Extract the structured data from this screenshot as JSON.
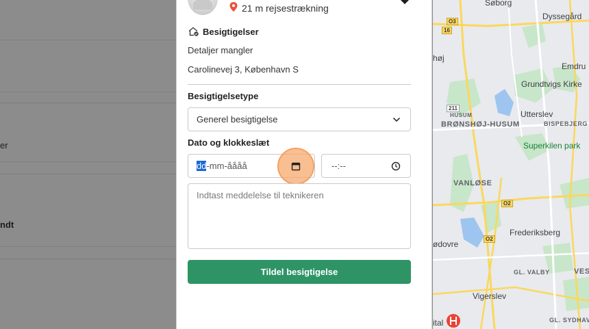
{
  "background_list": {
    "snippets": [
      "er",
      "ndt"
    ]
  },
  "panel": {
    "distance": "21 m rejsestrækning",
    "inspection_section": {
      "title": "Besigtigelser",
      "details": "Detaljer mangler",
      "address": "Carolinevej 3, København S"
    },
    "type_label": "Besigtigelsetype",
    "type_selected": "Generel besigtigelse",
    "datetime_label": "Dato og klokkeslæt",
    "date_placeholder_selected": "dd",
    "date_placeholder_rest": "-mm-åååå",
    "time_placeholder": "--:--",
    "message_placeholder": "Indtast meddelelse til teknikeren",
    "submit_label": "Tildel besigtigelse"
  },
  "map": {
    "places": [
      "Søborg",
      "Dyssegård",
      "Emdru",
      "Grundtvigs Kirke",
      "Utterslev",
      "Superkilen park",
      "Frederiksberg",
      "Vigerslev",
      "høj",
      "ødovre",
      "ital"
    ],
    "districts": [
      "BRØNSHØJ-HUSUM",
      "BISPEBJERG",
      "VANLØSE",
      "GL. VALBY",
      "VES",
      "GL. SYDHAVN",
      "HUSUM"
    ],
    "road_numbers": [
      "O3",
      "16",
      "211",
      "O2",
      "O2"
    ],
    "colors": {
      "park": "#c8e6c9",
      "water": "#9ec5f0",
      "road": "#fbd75b",
      "accent_button": "#2e9466",
      "highlight": "#f5a05d"
    }
  }
}
